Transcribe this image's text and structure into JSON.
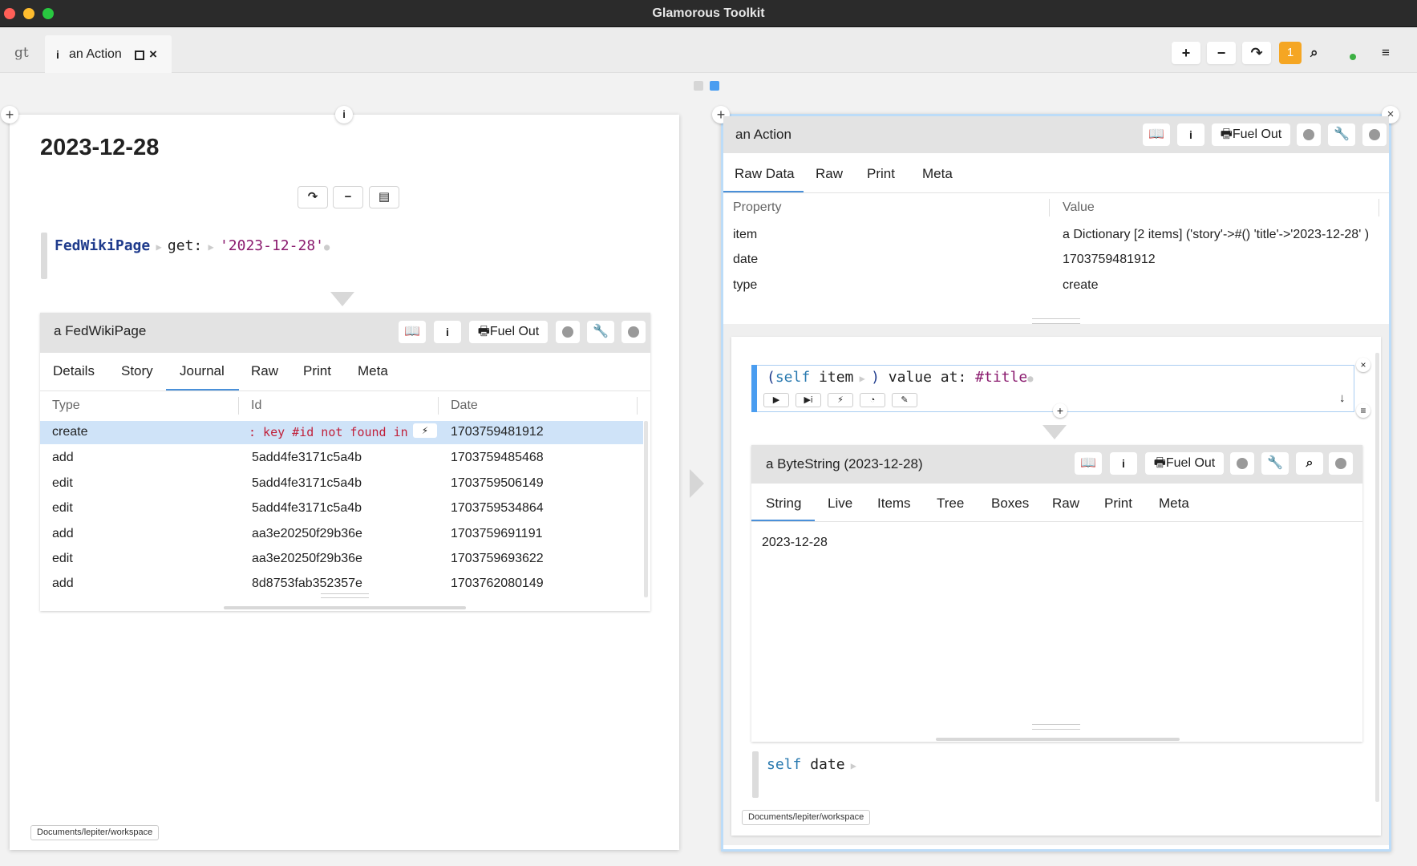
{
  "app": {
    "title": "Glamorous Toolkit"
  },
  "tabbar": {
    "logo": "gt",
    "tab_icon": "i",
    "tab_label": "an Action",
    "badge_count": "1"
  },
  "left": {
    "page_title": "2023-12-28",
    "snippet": {
      "receiver": "FedWikiPage",
      "selector": "get:",
      "argument": "'2023-12-28'"
    },
    "inspector": {
      "title": "a FedWikiPage",
      "fuel_label": "Fuel Out",
      "tabs": [
        "Details",
        "Story",
        "Journal",
        "Raw",
        "Print",
        "Meta"
      ],
      "active_tab": "Journal",
      "columns": [
        "Type",
        "Id",
        "Date"
      ],
      "error_text": ": key #id not found in",
      "rows": [
        {
          "type": "create",
          "id": "",
          "date": "1703759481912"
        },
        {
          "type": "add",
          "id": "5add4fe3171c5a4b",
          "date": "1703759485468"
        },
        {
          "type": "edit",
          "id": "5add4fe3171c5a4b",
          "date": "1703759506149"
        },
        {
          "type": "edit",
          "id": "5add4fe3171c5a4b",
          "date": "1703759534864"
        },
        {
          "type": "add",
          "id": "aa3e20250f29b36e",
          "date": "1703759691191"
        },
        {
          "type": "edit",
          "id": "aa3e20250f29b36e",
          "date": "1703759693622"
        },
        {
          "type": "add",
          "id": "8d8753fab352357e",
          "date": "1703762080149"
        }
      ]
    },
    "footer": "Documents/lepiter/workspace"
  },
  "right": {
    "title": "an Action",
    "fuel_label": "Fuel Out",
    "tabs": [
      "Raw Data",
      "Raw",
      "Print",
      "Meta"
    ],
    "active_tab": "Raw Data",
    "columns": [
      "Property",
      "Value"
    ],
    "rows": [
      {
        "property": "item",
        "value": "a Dictionary [2 items] ('story'->#() 'title'->'2023-12-28' )"
      },
      {
        "property": "date",
        "value": "1703759481912"
      },
      {
        "property": "type",
        "value": "create"
      }
    ],
    "snippet": {
      "open_paren": "(",
      "self": "self",
      "msg": "item",
      "close_paren": ")",
      "rest": "value at:",
      "symbol": "#title"
    },
    "bytestring": {
      "title": "a ByteString (2023-12-28)",
      "fuel_label": "Fuel Out",
      "tabs": [
        "String",
        "Live",
        "Items",
        "Tree",
        "Boxes",
        "Raw",
        "Print",
        "Meta"
      ],
      "active_tab": "String",
      "content": "2023-12-28"
    },
    "snippet2": {
      "self": "self",
      "msg": "date"
    },
    "footer": "Documents/lepiter/workspace"
  },
  "colors": {
    "accent": "#4a90d9",
    "selection": "#cfe3f8",
    "badge": "#f5a623",
    "keyword": "#1f3b8c",
    "string": "#8a1a6e",
    "error": "#c0203a"
  }
}
